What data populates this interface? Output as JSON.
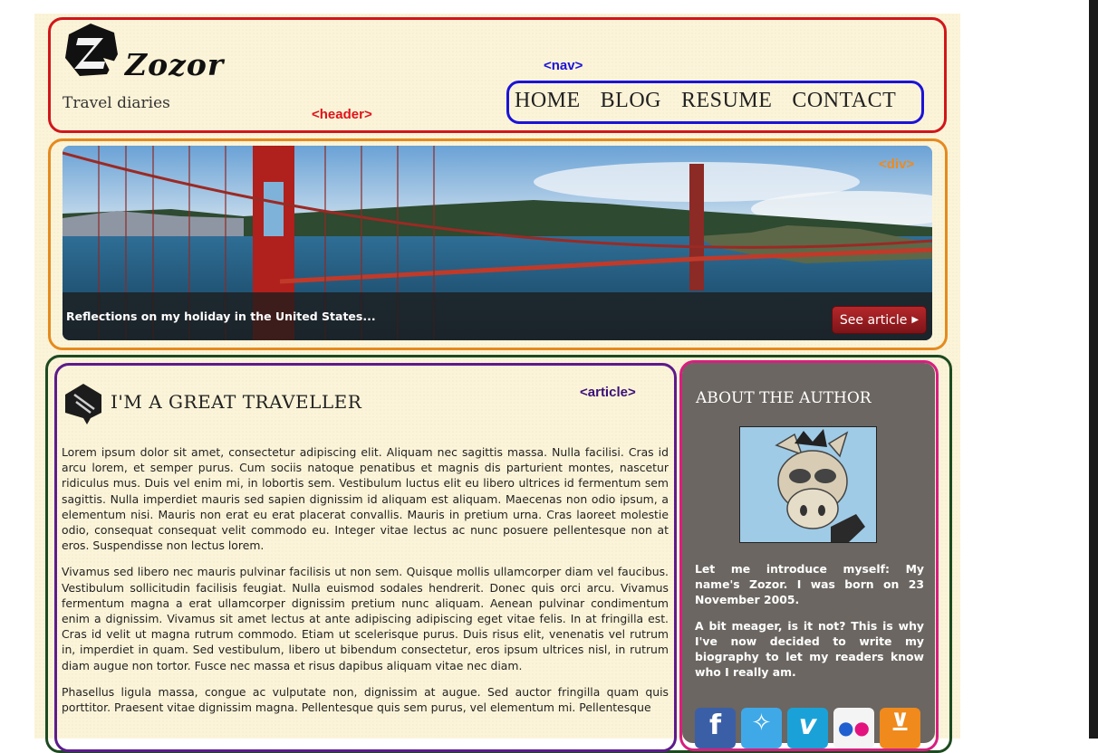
{
  "header": {
    "logo_text": "Zozor",
    "tagline": "Travel diaries",
    "tag_label": "<header>"
  },
  "nav": {
    "tag_label": "<nav>",
    "items": [
      {
        "label": "HOME"
      },
      {
        "label": "BLOG"
      },
      {
        "label": "RESUME"
      },
      {
        "label": "CONTACT"
      }
    ]
  },
  "banner": {
    "tag_label": "<div>",
    "caption": "Reflections on my holiday in the United States...",
    "button_label": "See article",
    "button_icon": "triangle-right-icon"
  },
  "article": {
    "tag_label": "<article>",
    "title": "I'M A GREAT TRAVELLER",
    "paragraphs": [
      "Lorem ipsum dolor sit amet, consectetur adipiscing elit. Aliquam nec sagittis massa. Nulla facilisi. Cras id arcu lorem, et semper purus. Cum sociis natoque penatibus et magnis dis parturient montes, nascetur ridiculus mus. Duis vel enim mi, in lobortis sem. Vestibulum luctus elit eu libero ultrices id fermentum sem sagittis. Nulla imperdiet mauris sed sapien dignissim id aliquam est aliquam. Maecenas non odio ipsum, a elementum nisi. Mauris non erat eu erat placerat convallis. Mauris in pretium urna. Cras laoreet molestie odio, consequat consequat velit commodo eu. Integer vitae lectus ac nunc posuere pellentesque non at eros. Suspendisse non lectus lorem.",
      "Vivamus sed libero nec mauris pulvinar facilisis ut non sem. Quisque mollis ullamcorper diam vel faucibus. Vestibulum sollicitudin facilisis feugiat. Nulla euismod sodales hendrerit. Donec quis orci arcu. Vivamus fermentum magna a erat ullamcorper dignissim pretium nunc aliquam. Aenean pulvinar condimentum enim a dignissim. Vivamus sit amet lectus at ante adipiscing adipiscing eget vitae felis. In at fringilla est. Cras id velit ut magna rutrum commodo. Etiam ut scelerisque purus. Duis risus elit, venenatis vel rutrum in, imperdiet in quam. Sed vestibulum, libero ut bibendum consectetur, eros ipsum ultrices nisl, in rutrum diam augue non tortor. Fusce nec massa et risus dapibus aliquam vitae nec diam.",
      "Phasellus ligula massa, congue ac vulputate non, dignissim at augue. Sed auctor fringilla quam quis porttitor. Praesent vitae dignissim magna. Pellentesque quis sem purus, vel elementum mi. Pellentesque"
    ]
  },
  "aside": {
    "title": "ABOUT THE AUTHOR",
    "paragraphs": [
      "Let me introduce myself: My name's Zozor. I was born on 23 November 2005.",
      "A bit meager, is it not? This is why I've now decided to write my biography to let my readers know who I really am."
    ],
    "socials": [
      {
        "name": "facebook-icon",
        "glyph": "f",
        "color": "#3b5fa6"
      },
      {
        "name": "twitter-icon",
        "glyph": "✧",
        "color": "#3fa9e8"
      },
      {
        "name": "vimeo-icon",
        "glyph": "v",
        "color": "#1aa2d8"
      },
      {
        "name": "flickr-icon",
        "glyph": "●●",
        "color": "#f4f4f4"
      },
      {
        "name": "rss-icon",
        "glyph": "☵",
        "color": "#f08a1c"
      }
    ]
  },
  "colors": {
    "header_outline": "#d1161b",
    "nav_outline": "#1b13d8",
    "div_outline": "#e58a1e",
    "article_outline": "#5c1b8c",
    "aside_outline": "#d81e80",
    "wrapper_outline": "#1d4a20"
  }
}
